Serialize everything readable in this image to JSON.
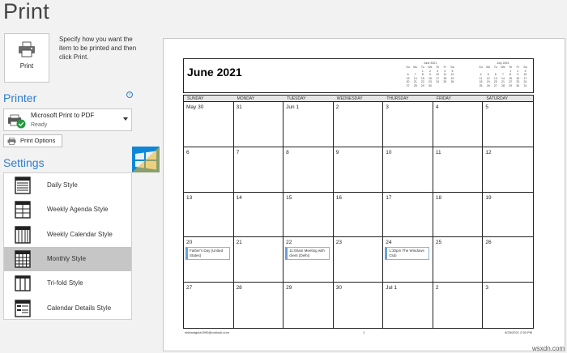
{
  "page_title": "Print",
  "print_button": {
    "label": "Print"
  },
  "print_description": "Specify how you want the item to be printed and then click Print.",
  "printer_section": {
    "heading": "Printer",
    "info_glyph": "i",
    "selected_printer": "Microsoft Print to PDF",
    "status": "Ready",
    "print_options_label": "Print Options"
  },
  "settings_section": {
    "heading": "Settings",
    "styles": [
      {
        "label": "Daily Style",
        "icon": "daily-style-icon",
        "selected": false
      },
      {
        "label": "Weekly Agenda Style",
        "icon": "weekly-agenda-style-icon",
        "selected": false
      },
      {
        "label": "Weekly Calendar Style",
        "icon": "weekly-calendar-style-icon",
        "selected": false
      },
      {
        "label": "Monthly Style",
        "icon": "monthly-style-icon",
        "selected": true
      },
      {
        "label": "Tri-fold Style",
        "icon": "trifold-style-icon",
        "selected": false
      },
      {
        "label": "Calendar Details Style",
        "icon": "calendar-details-style-icon",
        "selected": false
      }
    ]
  },
  "preview": {
    "month_title": "June 2021",
    "mini_calendars": [
      {
        "title": "June 2021",
        "days": [
          "Su",
          "Mo",
          "Tu",
          "We",
          "Th",
          "Fr",
          "Sa"
        ],
        "weeks": [
          [
            "",
            "",
            "1",
            "2",
            "3",
            "4",
            "5"
          ],
          [
            "6",
            "7",
            "8",
            "9",
            "10",
            "11",
            "12"
          ],
          [
            "13",
            "14",
            "15",
            "16",
            "17",
            "18",
            "19"
          ],
          [
            "20",
            "21",
            "22",
            "23",
            "24",
            "25",
            "26"
          ],
          [
            "27",
            "28",
            "29",
            "30",
            "",
            "",
            ""
          ]
        ]
      },
      {
        "title": "July 2021",
        "days": [
          "Su",
          "Mo",
          "Tu",
          "We",
          "Th",
          "Fr",
          "Sa"
        ],
        "weeks": [
          [
            "",
            "",
            "",
            "",
            "1",
            "2",
            "3"
          ],
          [
            "4",
            "5",
            "6",
            "7",
            "8",
            "9",
            "10"
          ],
          [
            "11",
            "12",
            "13",
            "14",
            "15",
            "16",
            "17"
          ],
          [
            "18",
            "19",
            "20",
            "21",
            "22",
            "23",
            "24"
          ],
          [
            "25",
            "26",
            "27",
            "28",
            "29",
            "30",
            "31"
          ]
        ]
      }
    ],
    "weekdays": [
      "SUNDAY",
      "MONDAY",
      "TUESDAY",
      "WEDNESDAY",
      "THURSDAY",
      "FRIDAY",
      "SATURDAY"
    ],
    "weeks": [
      [
        {
          "day": "May 30"
        },
        {
          "day": "31"
        },
        {
          "day": "Jun 1"
        },
        {
          "day": "2"
        },
        {
          "day": "3"
        },
        {
          "day": "4"
        },
        {
          "day": "5"
        }
      ],
      [
        {
          "day": "6"
        },
        {
          "day": "7"
        },
        {
          "day": "8"
        },
        {
          "day": "9"
        },
        {
          "day": "10"
        },
        {
          "day": "11"
        },
        {
          "day": "12"
        }
      ],
      [
        {
          "day": "13"
        },
        {
          "day": "14"
        },
        {
          "day": "15"
        },
        {
          "day": "16"
        },
        {
          "day": "17"
        },
        {
          "day": "18"
        },
        {
          "day": "19"
        }
      ],
      [
        {
          "day": "20",
          "event": "Father's Day (United States)"
        },
        {
          "day": "21"
        },
        {
          "day": "22",
          "event": "11:00am Meeting with client (Delhi)"
        },
        {
          "day": "23"
        },
        {
          "day": "24",
          "event": "1:30pm The Windows Club"
        },
        {
          "day": "25"
        },
        {
          "day": "26"
        }
      ],
      [
        {
          "day": "27"
        },
        {
          "day": "28"
        },
        {
          "day": "29"
        },
        {
          "day": "30"
        },
        {
          "day": "Jul 1"
        },
        {
          "day": "2"
        },
        {
          "day": "3"
        }
      ]
    ],
    "footer": {
      "left": "nishantgula1990@outlook.com",
      "center": "1",
      "right": "6/25/2021 2:30 PM"
    }
  },
  "watermark": "wsxdn.com"
}
